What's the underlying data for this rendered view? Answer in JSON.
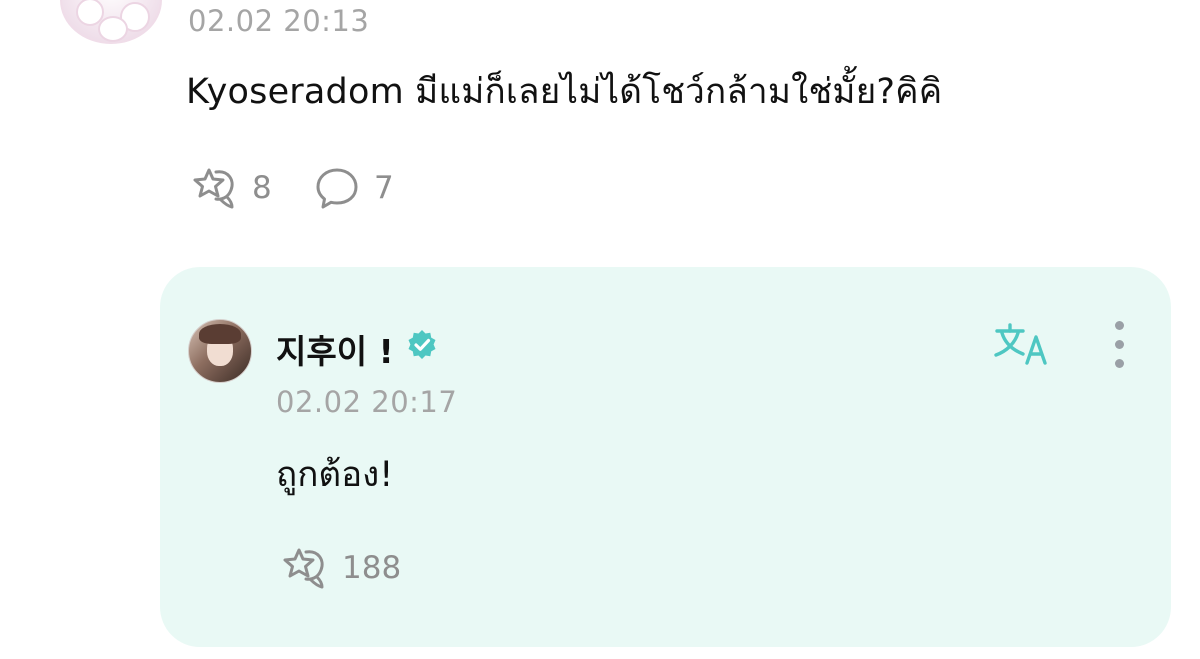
{
  "comment": {
    "time": "02.02 20:13",
    "text": "Kyoseradom มีแม่ก็เลยไม่ได้โชว์กล้ามใช่มั้ย?คิคิ",
    "like_count": "8",
    "reply_count": "7",
    "icons": {
      "avatar": "avatar",
      "like": "like-icon",
      "reply": "comment-bubble-icon"
    }
  },
  "reply": {
    "author_name": "지후이 !",
    "time": "02.02 20:17",
    "text": "ถูกต้อง!",
    "like_count": "188",
    "icons": {
      "verified": "verified-badge-icon",
      "translate": "translate-icon",
      "more": "more-vertical-icon",
      "like": "like-icon"
    }
  },
  "colors": {
    "accent": "#4ec7c2",
    "card_background": "#e9f9f5",
    "meta_text": "#a5a5a5",
    "icon_gray": "#8e8e8e"
  }
}
